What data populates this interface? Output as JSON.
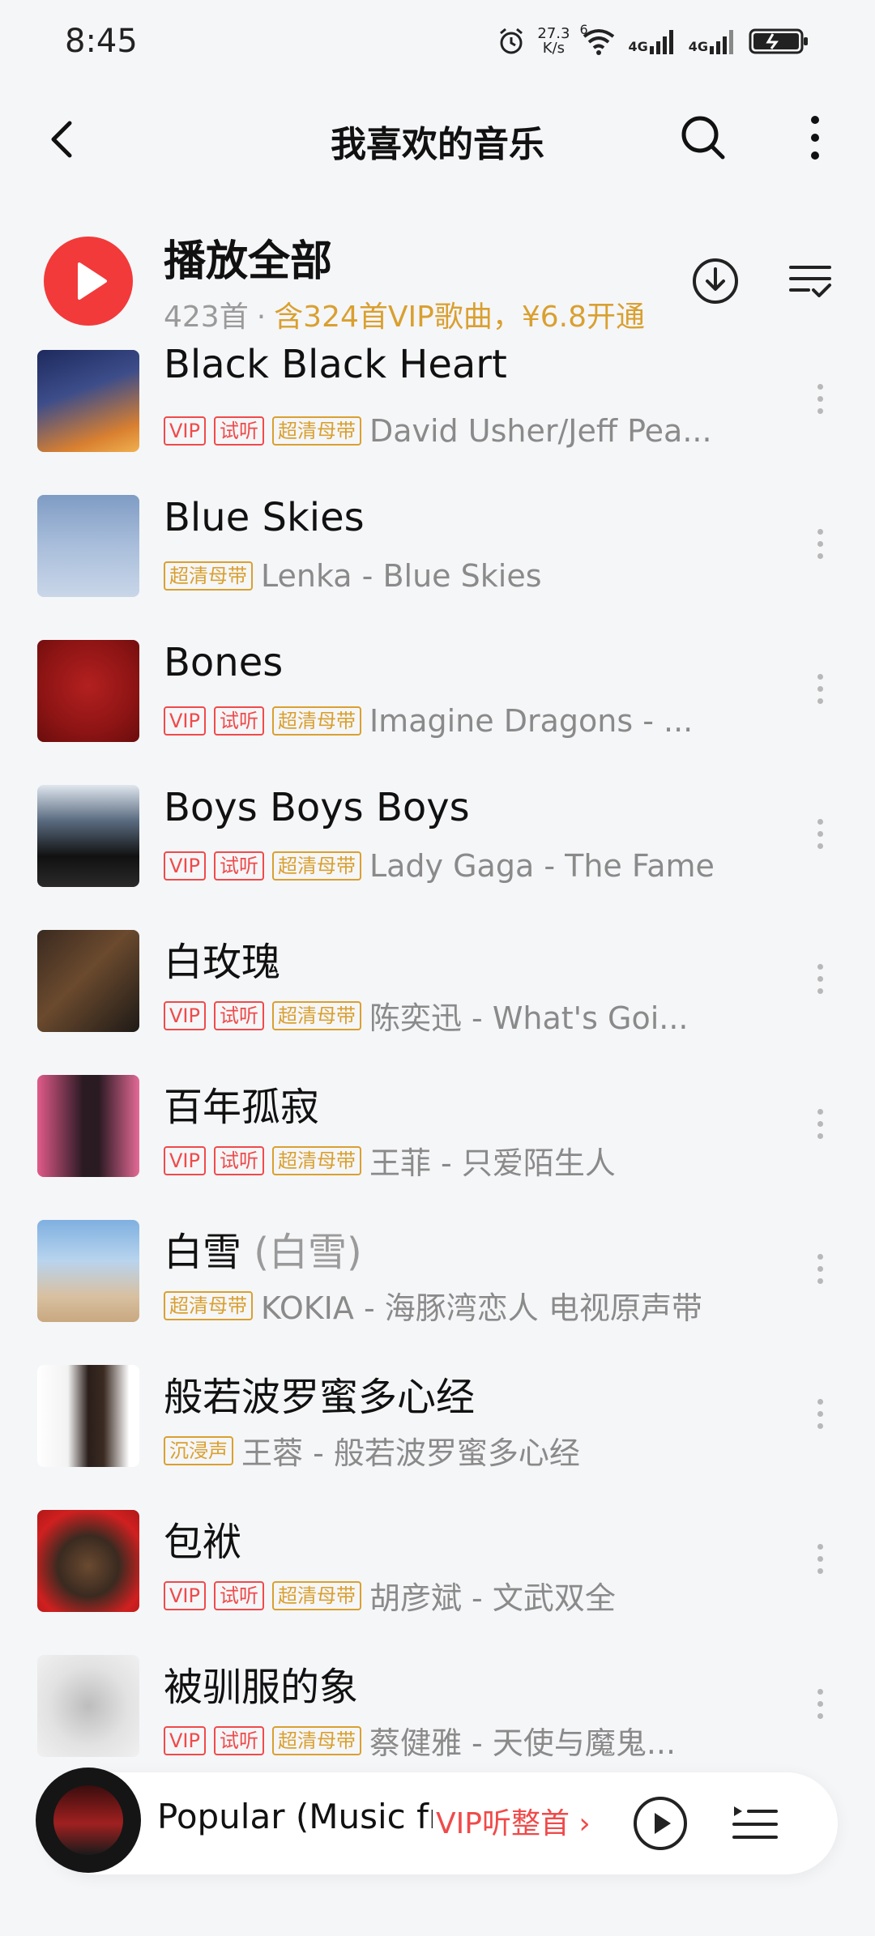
{
  "status_bar": {
    "time": "8:45",
    "net_speed_value": "27.3",
    "net_speed_unit": "K/s",
    "wifi_badge": "6",
    "signal1_label": "4G",
    "signal2_label": "4G"
  },
  "header": {
    "title": "我喜欢的音乐"
  },
  "play_all": {
    "label": "播放全部",
    "count": "423首",
    "separator": "·",
    "vip_promo": "含324首VIP歌曲，¥6.8开通"
  },
  "tags": {
    "vip": "VIP",
    "trial": "试听",
    "hq": "超清母带",
    "immersive": "沉浸声"
  },
  "songs": [
    {
      "title": "Black Black Heart",
      "meta": "David Usher/Jeff Pea..."
    },
    {
      "title": "Blue Skies",
      "meta": "Lenka - Blue Skies"
    },
    {
      "title": "Bones",
      "meta": "Imagine Dragons - ..."
    },
    {
      "title": "Boys Boys Boys",
      "meta": "Lady Gaga - The Fame"
    },
    {
      "title": "白玫瑰",
      "meta": "陈奕迅 - What's Goi..."
    },
    {
      "title": "百年孤寂",
      "meta": "王菲 - 只爱陌生人"
    },
    {
      "title": "白雪",
      "title_sub": " (白雪)",
      "meta": "KOKIA - 海豚湾恋人 电视原声带"
    },
    {
      "title": "般若波罗蜜多心经",
      "meta": "王蓉 - 般若波罗蜜多心经"
    },
    {
      "title": "包袱",
      "meta": "胡彦斌 - 文武双全"
    },
    {
      "title": "被驯服的象",
      "meta": "蔡健雅 - 天使与魔鬼..."
    }
  ],
  "mini_player": {
    "title": "Popular (Music fr",
    "vip_cta": "VIP听整首 ›"
  },
  "colors": {
    "accent_red": "#f23a3a",
    "vip_gold": "#d9a030",
    "background": "#f5f6f8"
  }
}
